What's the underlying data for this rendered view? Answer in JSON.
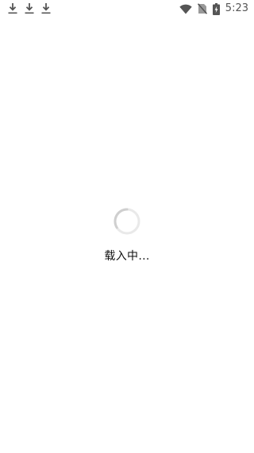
{
  "status_bar": {
    "time": "5:23",
    "left_icons": [
      "download-icon",
      "download-icon",
      "download-icon"
    ],
    "right_icons": [
      "wifi-icon",
      "no-sim-icon",
      "battery-charging-icon"
    ]
  },
  "loading": {
    "text": "载入中..."
  }
}
